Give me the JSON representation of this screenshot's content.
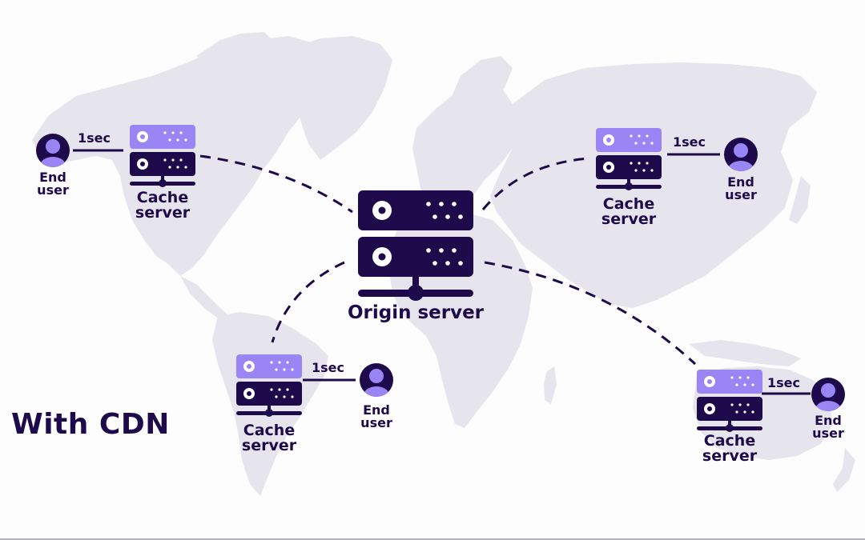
{
  "title": "With CDN",
  "colors": {
    "dark": "#1e0a4a",
    "accent": "#9a85f5",
    "land": "#e6e4ec",
    "background": "#fdfdfe"
  },
  "origin": {
    "label": "Origin server",
    "icon": "server-stack-icon"
  },
  "nodes": [
    {
      "id": "north-america",
      "cache_label": "Cache server",
      "user_label": "End user",
      "latency": "1sec"
    },
    {
      "id": "asia",
      "cache_label": "Cache server",
      "user_label": "End user",
      "latency": "1sec"
    },
    {
      "id": "south-america",
      "cache_label": "Cache server",
      "user_label": "End user",
      "latency": "1sec"
    },
    {
      "id": "oceania",
      "cache_label": "Cache server",
      "user_label": "End user",
      "latency": "1sec"
    }
  ]
}
